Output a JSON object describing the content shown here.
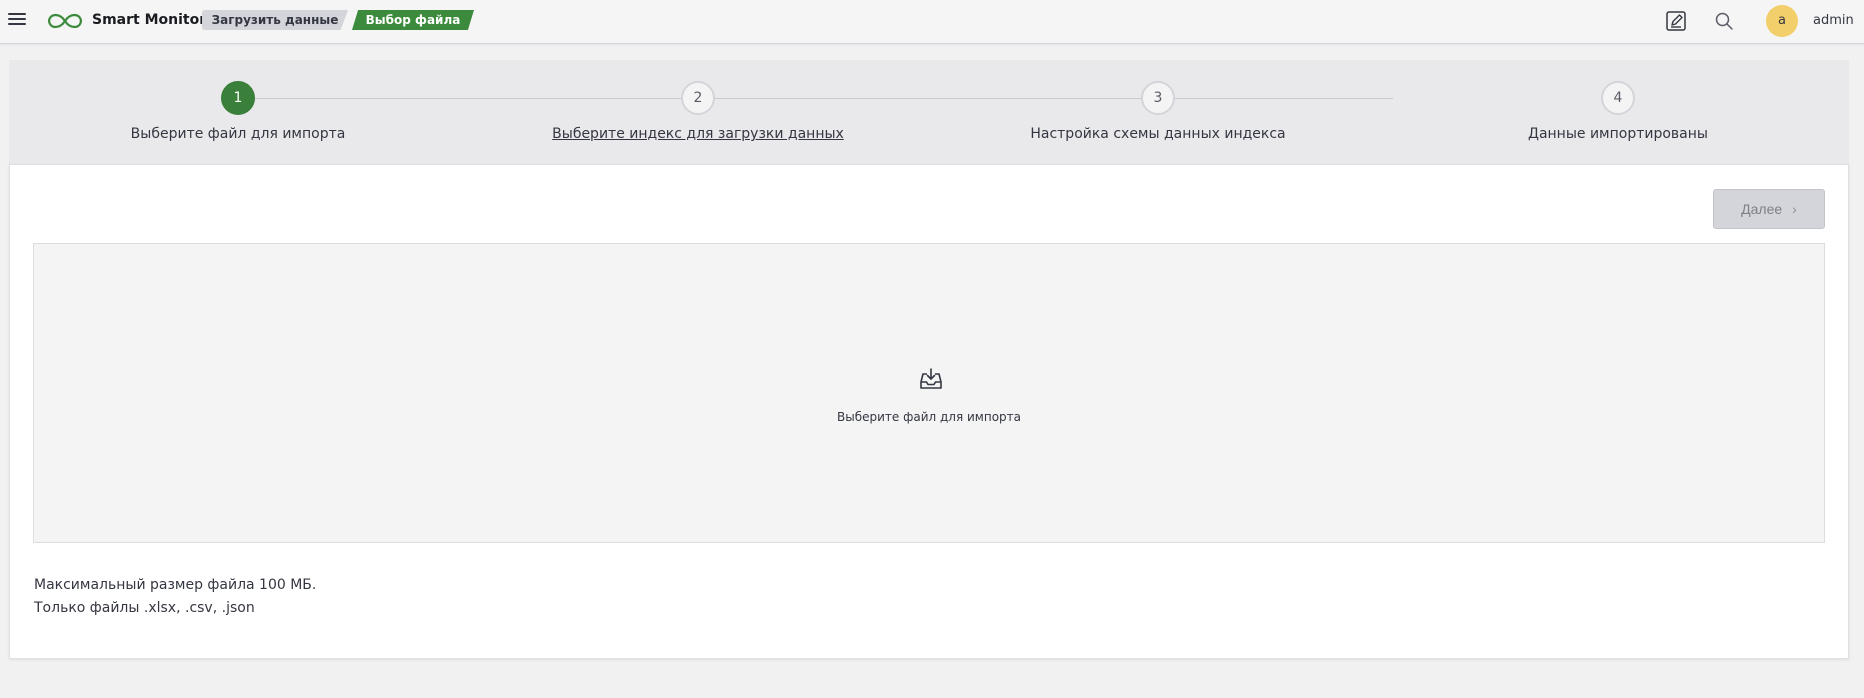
{
  "header": {
    "brand": "Smart Monitor",
    "breadcrumbs": [
      "Загрузить данные",
      "Выбор файла"
    ],
    "avatar_initial": "a",
    "username": "admin",
    "colors": {
      "accent": "#3c8b3c",
      "avatar": "#f2cf6a"
    },
    "icons": [
      "menu-icon",
      "logo-icon",
      "edit-icon",
      "search-icon"
    ]
  },
  "steps": [
    {
      "number": "1",
      "label": "Выберите файл для импорта",
      "active": true
    },
    {
      "number": "2",
      "label": "Выберите индекс для загрузки данных",
      "active": false
    },
    {
      "number": "3",
      "label": "Настройка схемы данных индекса",
      "active": false
    },
    {
      "number": "4",
      "label": "Данные импортированы",
      "active": false
    }
  ],
  "main": {
    "next_label": "Далее",
    "dropzone_text": "Выберите файл для импорта",
    "dropzone_icon": "upload-tray-icon",
    "hints": [
      "Максимальный размер файла 100 МБ.",
      "Только файлы .xlsx, .csv, .json"
    ]
  }
}
